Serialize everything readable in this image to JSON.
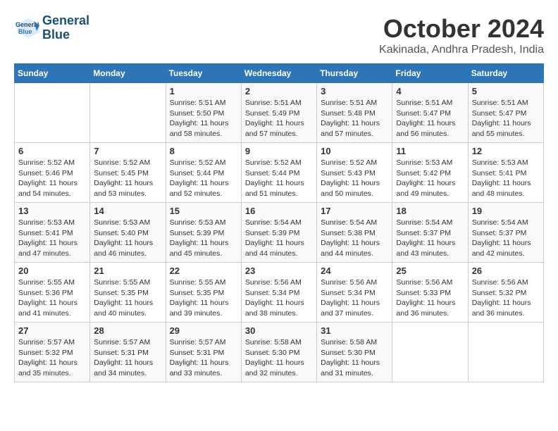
{
  "header": {
    "logo_line1": "General",
    "logo_line2": "Blue",
    "month": "October 2024",
    "location": "Kakinada, Andhra Pradesh, India"
  },
  "days_of_week": [
    "Sunday",
    "Monday",
    "Tuesday",
    "Wednesday",
    "Thursday",
    "Friday",
    "Saturday"
  ],
  "weeks": [
    [
      {
        "day": "",
        "info": ""
      },
      {
        "day": "",
        "info": ""
      },
      {
        "day": "1",
        "info": "Sunrise: 5:51 AM\nSunset: 5:50 PM\nDaylight: 11 hours and 58 minutes."
      },
      {
        "day": "2",
        "info": "Sunrise: 5:51 AM\nSunset: 5:49 PM\nDaylight: 11 hours and 57 minutes."
      },
      {
        "day": "3",
        "info": "Sunrise: 5:51 AM\nSunset: 5:48 PM\nDaylight: 11 hours and 57 minutes."
      },
      {
        "day": "4",
        "info": "Sunrise: 5:51 AM\nSunset: 5:47 PM\nDaylight: 11 hours and 56 minutes."
      },
      {
        "day": "5",
        "info": "Sunrise: 5:51 AM\nSunset: 5:47 PM\nDaylight: 11 hours and 55 minutes."
      }
    ],
    [
      {
        "day": "6",
        "info": "Sunrise: 5:52 AM\nSunset: 5:46 PM\nDaylight: 11 hours and 54 minutes."
      },
      {
        "day": "7",
        "info": "Sunrise: 5:52 AM\nSunset: 5:45 PM\nDaylight: 11 hours and 53 minutes."
      },
      {
        "day": "8",
        "info": "Sunrise: 5:52 AM\nSunset: 5:44 PM\nDaylight: 11 hours and 52 minutes."
      },
      {
        "day": "9",
        "info": "Sunrise: 5:52 AM\nSunset: 5:44 PM\nDaylight: 11 hours and 51 minutes."
      },
      {
        "day": "10",
        "info": "Sunrise: 5:52 AM\nSunset: 5:43 PM\nDaylight: 11 hours and 50 minutes."
      },
      {
        "day": "11",
        "info": "Sunrise: 5:53 AM\nSunset: 5:42 PM\nDaylight: 11 hours and 49 minutes."
      },
      {
        "day": "12",
        "info": "Sunrise: 5:53 AM\nSunset: 5:41 PM\nDaylight: 11 hours and 48 minutes."
      }
    ],
    [
      {
        "day": "13",
        "info": "Sunrise: 5:53 AM\nSunset: 5:41 PM\nDaylight: 11 hours and 47 minutes."
      },
      {
        "day": "14",
        "info": "Sunrise: 5:53 AM\nSunset: 5:40 PM\nDaylight: 11 hours and 46 minutes."
      },
      {
        "day": "15",
        "info": "Sunrise: 5:53 AM\nSunset: 5:39 PM\nDaylight: 11 hours and 45 minutes."
      },
      {
        "day": "16",
        "info": "Sunrise: 5:54 AM\nSunset: 5:39 PM\nDaylight: 11 hours and 44 minutes."
      },
      {
        "day": "17",
        "info": "Sunrise: 5:54 AM\nSunset: 5:38 PM\nDaylight: 11 hours and 44 minutes."
      },
      {
        "day": "18",
        "info": "Sunrise: 5:54 AM\nSunset: 5:37 PM\nDaylight: 11 hours and 43 minutes."
      },
      {
        "day": "19",
        "info": "Sunrise: 5:54 AM\nSunset: 5:37 PM\nDaylight: 11 hours and 42 minutes."
      }
    ],
    [
      {
        "day": "20",
        "info": "Sunrise: 5:55 AM\nSunset: 5:36 PM\nDaylight: 11 hours and 41 minutes."
      },
      {
        "day": "21",
        "info": "Sunrise: 5:55 AM\nSunset: 5:35 PM\nDaylight: 11 hours and 40 minutes."
      },
      {
        "day": "22",
        "info": "Sunrise: 5:55 AM\nSunset: 5:35 PM\nDaylight: 11 hours and 39 minutes."
      },
      {
        "day": "23",
        "info": "Sunrise: 5:56 AM\nSunset: 5:34 PM\nDaylight: 11 hours and 38 minutes."
      },
      {
        "day": "24",
        "info": "Sunrise: 5:56 AM\nSunset: 5:34 PM\nDaylight: 11 hours and 37 minutes."
      },
      {
        "day": "25",
        "info": "Sunrise: 5:56 AM\nSunset: 5:33 PM\nDaylight: 11 hours and 36 minutes."
      },
      {
        "day": "26",
        "info": "Sunrise: 5:56 AM\nSunset: 5:32 PM\nDaylight: 11 hours and 36 minutes."
      }
    ],
    [
      {
        "day": "27",
        "info": "Sunrise: 5:57 AM\nSunset: 5:32 PM\nDaylight: 11 hours and 35 minutes."
      },
      {
        "day": "28",
        "info": "Sunrise: 5:57 AM\nSunset: 5:31 PM\nDaylight: 11 hours and 34 minutes."
      },
      {
        "day": "29",
        "info": "Sunrise: 5:57 AM\nSunset: 5:31 PM\nDaylight: 11 hours and 33 minutes."
      },
      {
        "day": "30",
        "info": "Sunrise: 5:58 AM\nSunset: 5:30 PM\nDaylight: 11 hours and 32 minutes."
      },
      {
        "day": "31",
        "info": "Sunrise: 5:58 AM\nSunset: 5:30 PM\nDaylight: 11 hours and 31 minutes."
      },
      {
        "day": "",
        "info": ""
      },
      {
        "day": "",
        "info": ""
      }
    ]
  ]
}
